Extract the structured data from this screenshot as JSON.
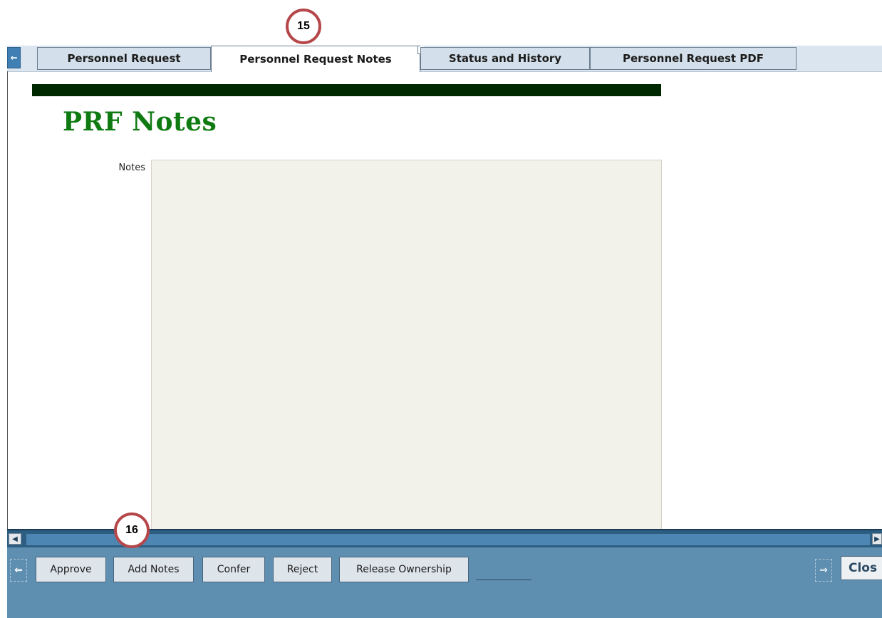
{
  "callouts": {
    "top": "15",
    "bottom": "16"
  },
  "tabs": [
    {
      "label": "Personnel Request",
      "active": false
    },
    {
      "label": "Personnel Request Notes",
      "active": true
    },
    {
      "label": "Status and History",
      "active": false
    },
    {
      "label": "Personnel Request PDF",
      "active": false
    }
  ],
  "page": {
    "title": "PRF Notes",
    "notes_label": "Notes",
    "notes_value": ""
  },
  "toolbar": {
    "approve": "Approve",
    "add_notes": "Add Notes",
    "confer": "Confer",
    "reject": "Reject",
    "release_ownership": "Release Ownership",
    "close": "Clos"
  },
  "colors": {
    "title_green": "#0f7a12",
    "bar_dark_green": "#002800",
    "toolbar_blue": "#5f8fb0",
    "callout_red": "#b5474a"
  },
  "icons": [
    "back-arrow-icon",
    "forward-arrow-icon",
    "scroll-left-icon",
    "scroll-right-icon"
  ]
}
